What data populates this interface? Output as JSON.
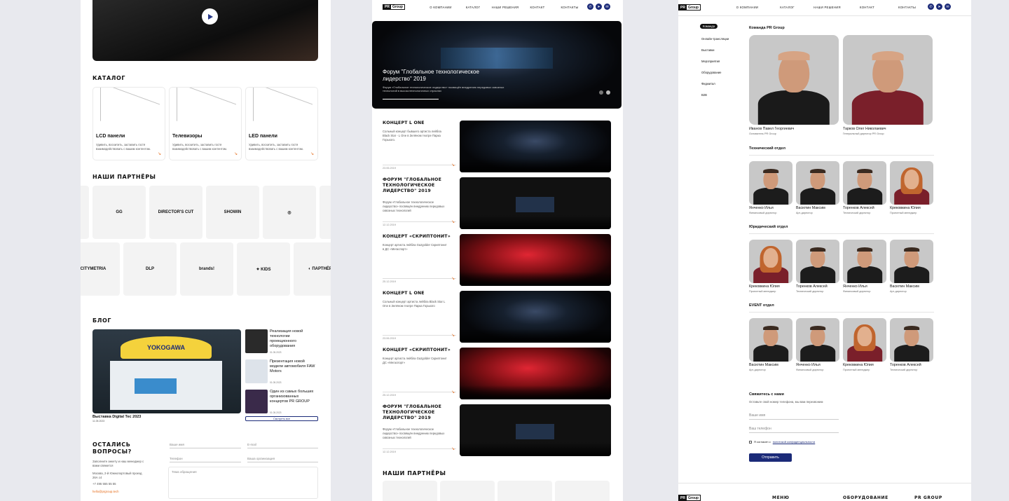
{
  "panel1": {
    "catalog_title": "КАТАЛОГ",
    "catalog": [
      {
        "title": "LCD панели",
        "desc": "Удивить, восхитить, заставить гостя взаимодействовать с вашим контентом."
      },
      {
        "title": "Телевизоры",
        "desc": "Удивить, восхитить, заставить гостя взаимодействовать с вашим контентом."
      },
      {
        "title": "LED панели",
        "desc": "Удивить, восхитить, заставить гостя взаимодействовать с вашим контентом."
      }
    ],
    "partners_title": "НАШИ ПАРТНЁРЫ",
    "partners_row1": [
      "GG",
      "DIRECTOR'S CUT",
      "SHOWIN",
      "◎"
    ],
    "partners_row2": [
      "CITYMETRIA",
      "DLP",
      "brands!",
      "✦ KIDS",
      "◐ ПАРТНЁР"
    ],
    "blog_title": "БЛОГ",
    "blog_main": {
      "title": "Выставка Digital Tec 2023",
      "date": "11.05.2023",
      "banner": "YOKOGAWA"
    },
    "blog_items": [
      {
        "title": "Реализация новой технологии проекционного оборудования",
        "date": "01.05.2023"
      },
      {
        "title": "Презентация новой модели автомобиля FAW Motors",
        "date": "01.05.2023"
      },
      {
        "title": "Один из самых больших организованных концертов PR GROUP",
        "date": "01.05.2023"
      }
    ],
    "blog_button": "Смотреть все",
    "questions_title": "ОСТАЛИСЬ ВОПРОСЫ?",
    "questions_text": "Заполните анкету и наш менеджер с вами свяжется",
    "address": "Москва, 2-й Южнопортовый проезд 26А с4",
    "phone": "+7 495 555 55 55",
    "email": "hello@prgroup.tech",
    "form": {
      "name": "Ваше имя",
      "email": "E-mail",
      "phone": "Телефон",
      "org": "Ваша организация",
      "message": "Тема обращения"
    }
  },
  "panel2": {
    "logo_pr": "PR",
    "logo_group": "Group",
    "nav": [
      "О КОМПАНИИ",
      "КАТАЛОГ",
      "НАШИ РЕШЕНИЯ",
      "КОНТАКТ",
      "КОНТАКТЫ"
    ],
    "hero_title": "Форум \"Глобальное технологическое лидерство\" 2019",
    "hero_desc": "Форум «Глобальное технологическое лидерство» посвящён внедрению передовых сквозных технологий в высокотехнологичных отраслях",
    "events": [
      {
        "title": "КОНЦЕРТ L ONE",
        "desc": "Сольный концерт бывшего артиста лейбла Black Star - L One в Зелёном театре Парка Горького.",
        "date": "23.06.2019",
        "img": "stage"
      },
      {
        "title": "ФОРУМ \"ГЛОБАЛЬНОЕ ТЕХНОЛОГИЧЕСКОЕ ЛИДЕРСТВО\" 2019",
        "desc": "Форум «Глобальное технологическое лидерство» посвящён внедрению передовых сквозных технологий",
        "date": "12.12.2019",
        "img": "dark"
      },
      {
        "title": "КОНЦЕРТ «СКРИПТОНИТ»",
        "desc": "Концерт артиста лейбла Gazgolder Скриптонит в ДС «Мегаспорт»",
        "date": "25.12.2019",
        "img": "red"
      },
      {
        "title": "КОНЦЕРТ L ONE",
        "desc": "Сольный концерт артиста лейбла Black Star L One в Зелёном театре Парка Горького",
        "date": "23.06.2019",
        "img": "stage"
      },
      {
        "title": "КОНЦЕРТ «СКРИПТОНИТ»",
        "desc": "Концерт артиста лейбла Gazgolder Скриптонит ДС «Мегаспорт»",
        "date": "25.12.2019",
        "img": "red"
      },
      {
        "title": "ФОРУМ \"ГЛОБАЛЬНОЕ ТЕХНОЛОГИЧЕСКОЕ ЛИДЕРСТВО\" 2019",
        "desc": "Форум «Глобальное технологическое лидерство» посвящён внедрению передовых сквозных технологий",
        "date": "12.12.2019",
        "img": "dark"
      }
    ],
    "partners_title": "НАШИ ПАРТНЁРЫ"
  },
  "panel3": {
    "logo_pr": "PR",
    "logo_group": "Group",
    "nav": [
      "О КОМПАНИИ",
      "КАТАЛОГ",
      "НАШИ РЕШЕНИЯ",
      "КОНТАКТ",
      "КОНТАКТЫ"
    ],
    "sidebar": [
      "Команда",
      "Онлайн-трансляции",
      "Выставки",
      "Мероприятия",
      "Оборудование",
      "Фиджитал",
      "B2B"
    ],
    "team_title": "Команда PR Group",
    "leaders": [
      {
        "name": "Иванов Павел Георгиевич",
        "role": "Основатель PR Group"
      },
      {
        "name": "Тарков Олег Николаевич",
        "role": "Генеральный директор PR Group"
      }
    ],
    "depts": [
      {
        "title": "Технический отдел",
        "people": [
          {
            "name": "Янченко Илья",
            "role": "Финансовый директор",
            "g": "m"
          },
          {
            "name": "Васютин Максим",
            "role": "Арт-директор",
            "g": "m"
          },
          {
            "name": "Торенков Алексей",
            "role": "Технический директор",
            "g": "m"
          },
          {
            "name": "Крековкина Юлия",
            "role": "Проектный менеджер",
            "g": "f"
          }
        ]
      },
      {
        "title": "Юридический отдел",
        "people": [
          {
            "name": "Крековкина Юлия",
            "role": "Проектный менеджер",
            "g": "f"
          },
          {
            "name": "Торенков Алексей",
            "role": "Технический директор",
            "g": "m"
          },
          {
            "name": "Янченко Илья",
            "role": "Финансовый директор",
            "g": "m"
          },
          {
            "name": "Васютин Максим",
            "role": "Арт-директор",
            "g": "m"
          }
        ]
      },
      {
        "title": "EVENT отдел",
        "people": [
          {
            "name": "Васютин Максим",
            "role": "Арт-директор",
            "g": "m"
          },
          {
            "name": "Янченко Илья",
            "role": "Финансовый директор",
            "g": "m"
          },
          {
            "name": "Крековкина Юлия",
            "role": "Проектный менеджер",
            "g": "f"
          },
          {
            "name": "Торенков Алексей",
            "role": "Технический директор",
            "g": "m"
          }
        ]
      }
    ],
    "contact_title": "Свяжитесь с нами",
    "contact_text": "Оставьте свой номер телефона, мы вам перезвоним",
    "name_placeholder": "Ваше имя",
    "phone_placeholder": "Ваш телефон",
    "consent_prefix": "Я согласен с",
    "consent_link": "политикой конфиденциальности",
    "submit": "Отправить",
    "footer": [
      "МЕНЮ",
      "ОБОРУДОВАНИЕ",
      "PR GROUP"
    ]
  }
}
